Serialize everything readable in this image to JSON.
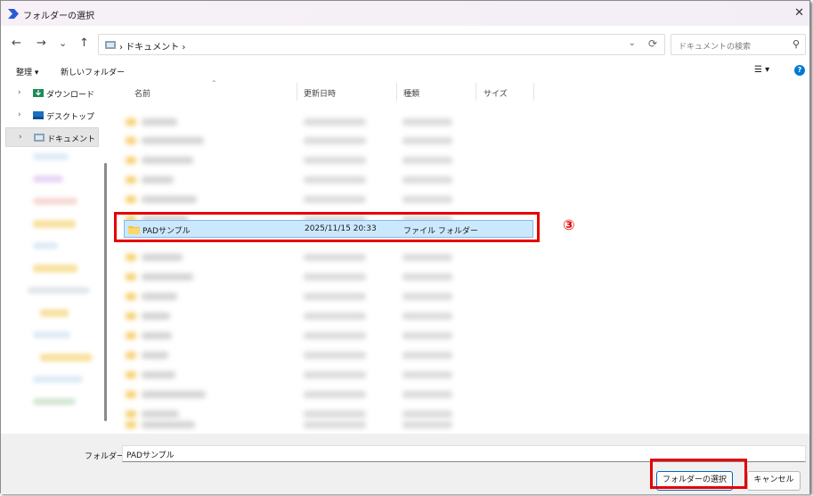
{
  "window": {
    "title": "フォルダーの選択"
  },
  "nav": {
    "back": "←",
    "forward": "→",
    "recent": "⌄",
    "up": "↑"
  },
  "address": {
    "breadcrumb": "› ドキュメント ›",
    "dropdown": "⌄",
    "refresh": "⟳"
  },
  "search": {
    "placeholder": "ドキュメントの検索"
  },
  "commandbar": {
    "organize": "整理 ▾",
    "new_folder": "新しいフォルダー",
    "view": "☰ ▾",
    "help": "?"
  },
  "sidebar": {
    "items": [
      {
        "label": "ダウンロード",
        "chevron": "›"
      },
      {
        "label": "デスクトップ",
        "chevron": "›"
      },
      {
        "label": "ドキュメント",
        "chevron": "›"
      }
    ]
  },
  "columns": {
    "name": "名前",
    "modified": "更新日時",
    "type": "種類",
    "size": "サイズ"
  },
  "selected_row": {
    "name": "PADサンプル",
    "modified": "2025/11/15 20:33",
    "type": "ファイル フォルダー"
  },
  "annotation": {
    "step": "③"
  },
  "footer": {
    "folder_label": "フォルダー:",
    "folder_value": "PADサンプル",
    "select_button": "フォルダーの選択",
    "cancel_button": "キャンセル"
  },
  "colors": {
    "selection": "#cce8ff",
    "highlight_box": "#e60000",
    "accent": "#0078d4"
  }
}
